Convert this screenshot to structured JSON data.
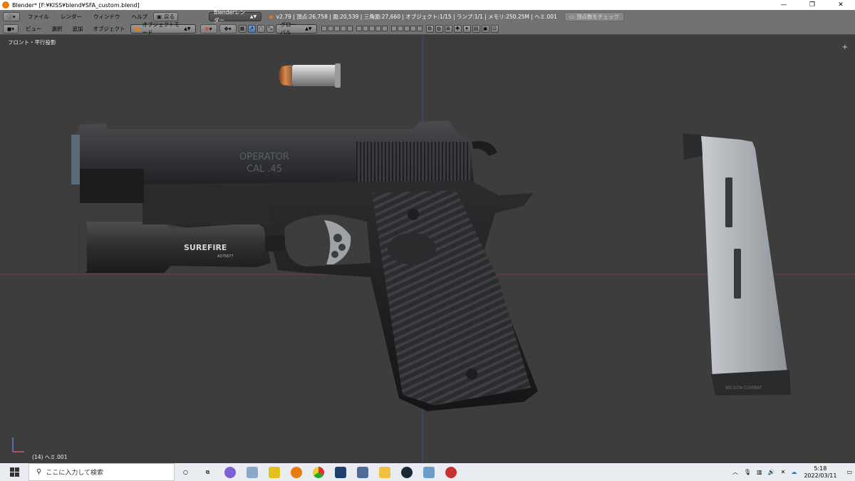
{
  "window": {
    "title": "Blender* [F:¥KISS¥blend¥SFA_custom.blend]",
    "minimize": "—",
    "maximize": "❐",
    "close": "✕"
  },
  "info_header": {
    "menus": [
      "ファイル",
      "レンダー",
      "ウィンドウ",
      "ヘルプ"
    ],
    "back_button": "戻る",
    "render_engine": "Blenderレンダー",
    "stats": "v2.79 | 頂点:26,758 | 面:20,539 | 三角面:27,660 | オブジェクト:1/15 | ランプ:1/1 | メモリ:250.25M | ヘミ.001",
    "check_vertex_button": "頂点数をチェック"
  },
  "view_header": {
    "menus": [
      "ビュー",
      "選択",
      "追加",
      "オブジェクト"
    ],
    "mode": "オブジェクトモード",
    "orientation": "グローバル"
  },
  "viewport": {
    "view_name": "フロント・平行投影",
    "object_info": "(14) ヘミ.001",
    "brand_text": "SUREFIRE",
    "serial_text": "A375677",
    "slide_text_1": "OPERATOR",
    "slide_text_2": "CAL .45",
    "mag_text": "WILSON COMBAT",
    "colors": {
      "background": "#3d3d3d",
      "x_axis": "#8a3b3b",
      "z_axis": "#3b4f8a"
    }
  },
  "taskbar": {
    "search_placeholder": "ここに入力して検索",
    "time": "5:18",
    "date": "2022/03/11"
  }
}
